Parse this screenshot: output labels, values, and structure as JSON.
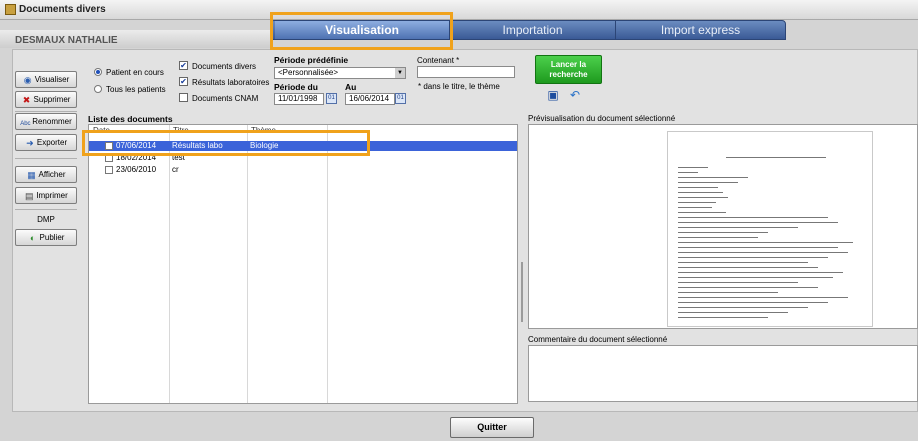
{
  "window": {
    "title": "Documents divers"
  },
  "patient": {
    "name": "DESMAUX NATHALIE"
  },
  "tabs": [
    {
      "label": "Visualisation",
      "active": true
    },
    {
      "label": "Importation",
      "active": false
    },
    {
      "label": "Import express",
      "active": false
    }
  ],
  "sidebar": {
    "visualiser": "Visualiser",
    "supprimer": "Supprimer",
    "renommer": "Renommer",
    "exporter": "Exporter",
    "afficher": "Afficher",
    "imprimer": "Imprimer",
    "dmp_label": "DMP",
    "publier": "Publier"
  },
  "filters": {
    "patient_en_cours": "Patient en cours",
    "tous_les_patients": "Tous les patients",
    "documents_divers": "Documents divers",
    "resultats_laboratoires": "Résultats laboratoires",
    "documents_cnam": "Documents CNAM",
    "periode_predefinie_label": "Période prédéfinie",
    "periode_predefinie_value": "<Personnalisée>",
    "periode_du_label": "Période du",
    "periode_du_value": "11/01/1998",
    "au_label": "Au",
    "au_value": "16/06/2014",
    "contenant_label": "Contenant *",
    "contenant_value": "",
    "contenant_note": "* dans le titre, le thème",
    "lancer_line1": "Lancer la",
    "lancer_line2": "recherche",
    "calendar_glyph": "01"
  },
  "documents": {
    "title": "Liste des documents",
    "columns": [
      "Date",
      "Titre",
      "Thème"
    ],
    "rows": [
      {
        "date": "07/06/2014",
        "titre": "Résultats labo",
        "theme": "Biologie"
      },
      {
        "date": "18/02/2014",
        "titre": "test",
        "theme": ""
      },
      {
        "date": "23/06/2010",
        "titre": "cr",
        "theme": ""
      }
    ]
  },
  "preview": {
    "title": "Prévisualisation du document sélectionné"
  },
  "comment": {
    "title": "Commentaire du document sélectionné"
  },
  "footer": {
    "quit_label": "Quitter"
  },
  "colors": {
    "accent": "#f0a21b",
    "tab_bar": "#3a5a96",
    "selection": "#3b63d9",
    "launch_green": "#2bb52b"
  }
}
